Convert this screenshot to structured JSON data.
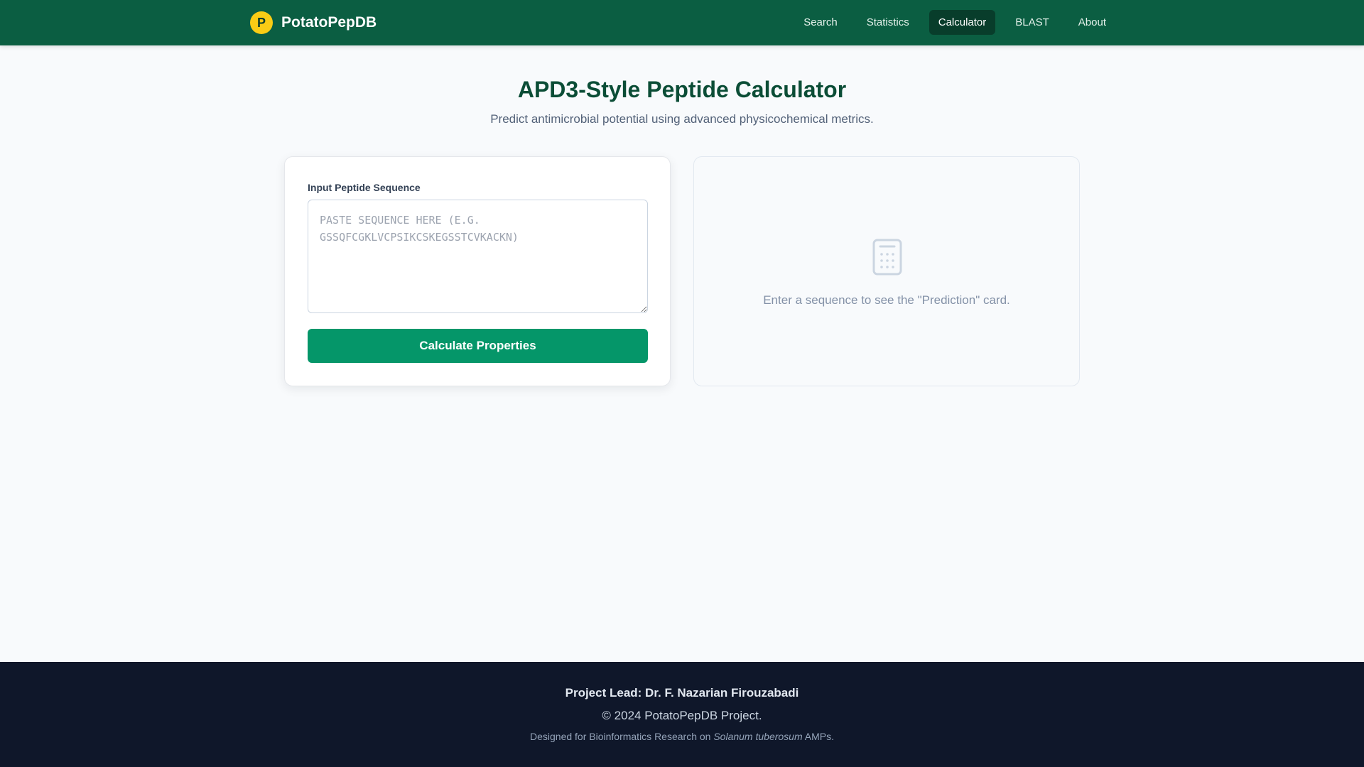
{
  "header": {
    "brand": {
      "logo_letter": "P",
      "name": "PotatoPepDB"
    },
    "nav": [
      {
        "label": "Search",
        "active": false
      },
      {
        "label": "Statistics",
        "active": false
      },
      {
        "label": "Calculator",
        "active": true
      },
      {
        "label": "BLAST",
        "active": false
      },
      {
        "label": "About",
        "active": false
      }
    ]
  },
  "hero": {
    "title": "APD3-Style Peptide Calculator",
    "subtitle": "Predict antimicrobial potential using advanced physicochemical metrics."
  },
  "input_card": {
    "label": "Input Peptide Sequence",
    "value": "",
    "placeholder": "Paste sequence here (e.g. GSSQFCGKLVCPSIKCSKEGSSTCVKACKN)",
    "button_label": "Calculate Properties"
  },
  "result_card": {
    "icon": "calculator-icon",
    "hint": "Enter a sequence to see the \"Prediction\" card."
  },
  "footer": {
    "lead": "Project Lead: Dr. F. Nazarian Firouzabadi",
    "copyright": "© 2024 PotatoPepDB Project.",
    "note_prefix": "Designed for Bioinformatics Research on ",
    "note_species": "Solanum tuberosum",
    "note_suffix": " AMPs."
  },
  "colors": {
    "header_bg": "#0b5e42",
    "nav_active_bg": "#083d2b",
    "brand_logo": "#facc15",
    "title": "#0b4d36",
    "primary_button": "#059669",
    "footer_bg": "#0f172a"
  }
}
